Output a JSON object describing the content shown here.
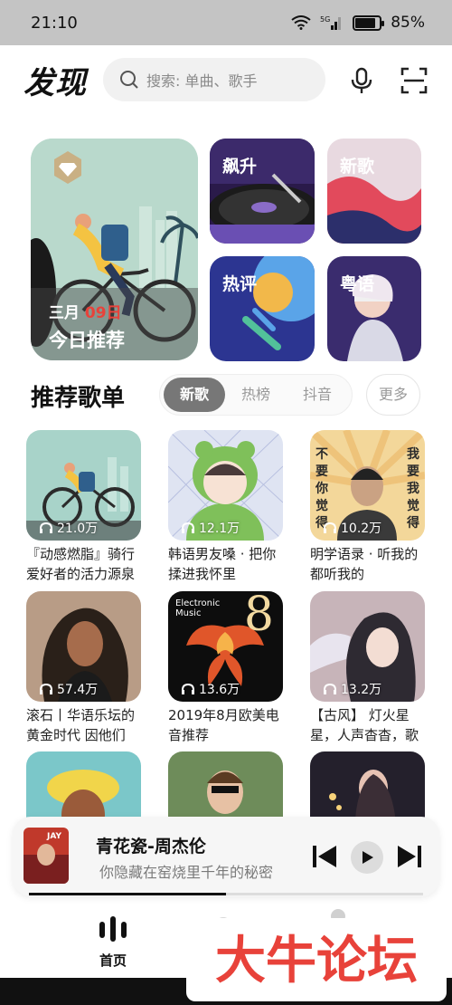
{
  "status": {
    "time": "21:10",
    "network": "5G",
    "battery": "85%",
    "battery_level": 0.85
  },
  "header": {
    "title": "发现",
    "search_placeholder": "搜索: 单曲、歌手"
  },
  "hero": {
    "date_month": "三月",
    "date_day": "09日",
    "title": "今日推荐"
  },
  "tiles": [
    {
      "label": "飙升"
    },
    {
      "label": "新歌"
    },
    {
      "label": "热评"
    },
    {
      "label": "粤语"
    }
  ],
  "section": {
    "title": "推荐歌单",
    "tabs": [
      "新歌",
      "热榜",
      "抖音"
    ],
    "active_tab": "新歌",
    "more": "更多"
  },
  "playlists": [
    {
      "plays": "21.0万",
      "title": "『动感燃脂』骑行爱好者的活力源泉"
    },
    {
      "plays": "12.1万",
      "title": "韩语男友嗓 · 把你揉进我怀里"
    },
    {
      "plays": "10.2万",
      "title": "明学语录 · 听我的都听我的",
      "cover_text_left": "不要你觉得",
      "cover_text_right": "我要我觉得"
    },
    {
      "plays": "57.4万",
      "title": "滚石丨华语乐坛的黄金时代 因他们"
    },
    {
      "plays": "13.6万",
      "title": "2019年8月欧美电音推荐",
      "cover_text": "Electronic Music",
      "cover_number": "8"
    },
    {
      "plays": "13.2万",
      "title": "【古风】 灯火星星，人声杳杳，歌"
    },
    {
      "plays": "",
      "title": ""
    },
    {
      "plays": "",
      "title": ""
    },
    {
      "plays": "",
      "title": ""
    }
  ],
  "player": {
    "song": "青花瓷-周杰伦",
    "lyric": "你隐藏在窑烧里千年的秘密",
    "progress": 0.5,
    "art_text": "JAY"
  },
  "nav": {
    "home": "首页"
  },
  "watermark": "大牛论坛",
  "colors": {
    "accent_red": "#e8423a",
    "tab_active": "#777777",
    "watermark": "#e8423a"
  }
}
